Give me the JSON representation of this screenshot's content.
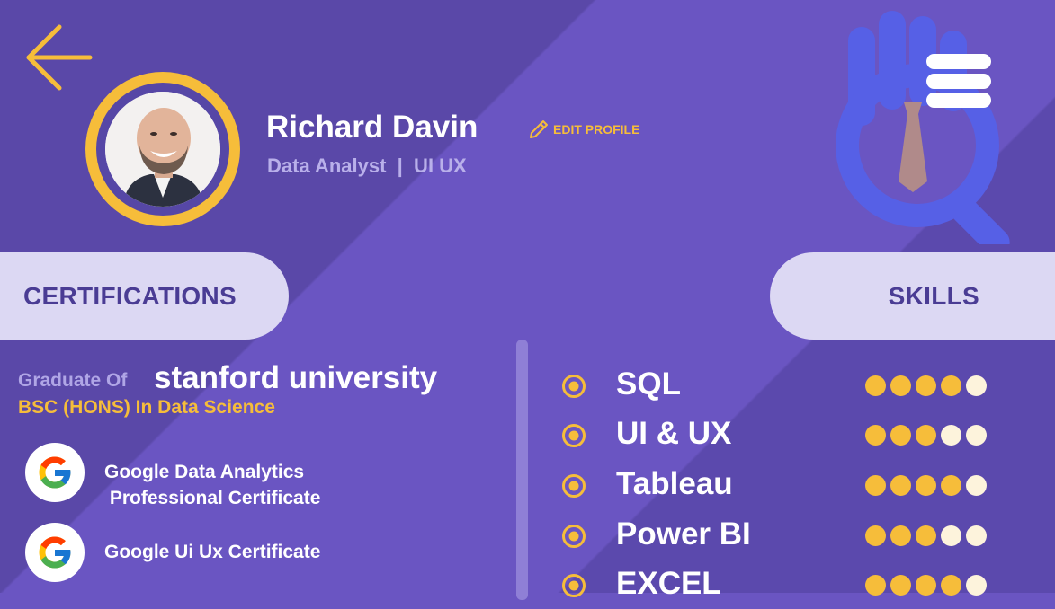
{
  "header": {
    "name": "Richard Davin",
    "role": "Data Analyst  |  UI UX",
    "edit_label": "EDIT PROFILE"
  },
  "icons": {
    "back": "arrow-left-icon",
    "menu": "hamburger-icon",
    "edit": "pencil-icon",
    "decoration": "hand-search-tie-icon"
  },
  "sections": {
    "certifications_title": "CERTIFICATIONS",
    "skills_title": "SKILLS"
  },
  "education": {
    "prefix": "Graduate Of",
    "university": "stanford university",
    "degree": "BSC (HONS) In Data Science"
  },
  "certifications": [
    {
      "title": "Google Data Analytics\n Professional Certificate",
      "logo": "google-logo"
    },
    {
      "title": "Google Ui Ux Certificate",
      "logo": "google-logo"
    }
  ],
  "skills": [
    {
      "name": "SQL",
      "rating": 4,
      "max": 5
    },
    {
      "name": "UI & UX",
      "rating": 3,
      "max": 5
    },
    {
      "name": "Tableau",
      "rating": 4,
      "max": 5
    },
    {
      "name": "Power BI",
      "rating": 3,
      "max": 5
    },
    {
      "name": "EXCEL",
      "rating": 4,
      "max": 5
    }
  ],
  "colors": {
    "background": "#6a55c2",
    "accent": "#f6bd3a",
    "pill": "#dcd8f3",
    "pill_text": "#4a3c94",
    "dot_filled": "#f6bd3a",
    "dot_empty": "#fdf3dc"
  }
}
